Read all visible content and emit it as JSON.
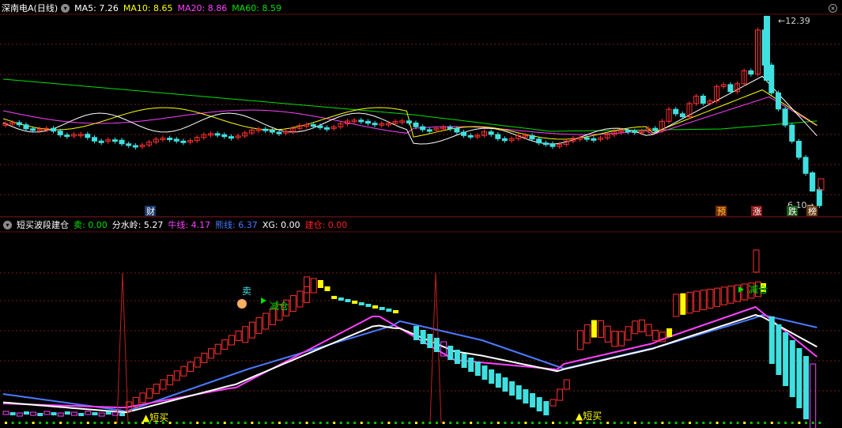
{
  "main_panel": {
    "title": "深南电A(日线)",
    "indicators": [
      {
        "label": "MA5: 7.26",
        "color": "#ffffff"
      },
      {
        "label": "MA10: 8.65",
        "color": "#ffff00"
      },
      {
        "label": "MA20: 8.86",
        "color": "#ff40ff"
      },
      {
        "label": "MA60: 8.59",
        "color": "#00e000"
      }
    ],
    "high_label": "12.39",
    "low_label": "6.10",
    "markers": [
      {
        "text": "财",
        "color": "#ffffff",
        "bg": "#1a3a6a"
      },
      {
        "text": "预",
        "color": "#ffd020",
        "bg": "#7a2a10"
      },
      {
        "text": "涨",
        "color": "#ffffff",
        "bg": "#8a1010"
      },
      {
        "text": "跌",
        "color": "#ffffff",
        "bg": "#1a5a1a"
      },
      {
        "text": "榜",
        "color": "#ffffff",
        "bg": "#6a3a10"
      }
    ]
  },
  "sub_panel": {
    "title": "短买波段建仓",
    "values": [
      {
        "label": "卖: 0.00",
        "color": "#00e000"
      },
      {
        "label": "分水岭: 5.27",
        "color": "#ffffff"
      },
      {
        "label": "牛线: 4.17",
        "color": "#ff40ff"
      },
      {
        "label": "熊线: 6.37",
        "color": "#4a7aff"
      },
      {
        "label": "XG: 0.00",
        "color": "#ffffff"
      },
      {
        "label": "建仓: 0.00",
        "color": "#ff2020"
      }
    ],
    "signals": {
      "sell": "卖",
      "reduce_1": "减仓",
      "reduce_2": "减仓",
      "buy_1": "▲短买",
      "buy_2": "▲短买"
    }
  },
  "colors": {
    "up": "#ff3030",
    "down": "#40e0e0",
    "grid": "#7a1a1a",
    "ma5": "#ffffff",
    "ma10": "#ffff00",
    "ma20": "#ff40ff",
    "ma60": "#00e000",
    "bull": "#ff40ff",
    "bear": "#4a7aff",
    "divide": "#ffffff",
    "accent_yellow": "#ffff00"
  }
}
